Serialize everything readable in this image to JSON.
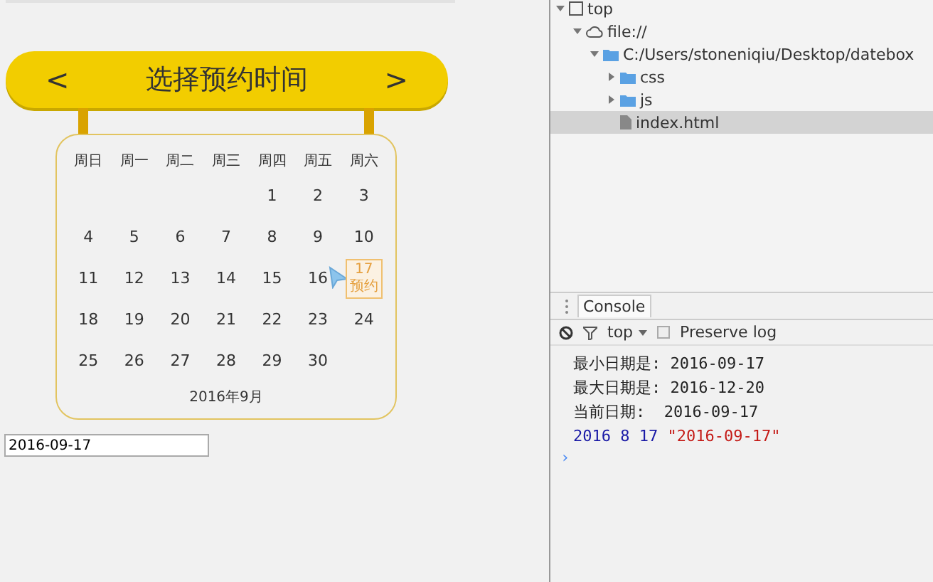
{
  "picker": {
    "prev": "<",
    "title": "选择预约时间",
    "next": ">",
    "weekdays": [
      "周日",
      "周一",
      "周二",
      "周三",
      "周四",
      "周五",
      "周六"
    ],
    "weeks": [
      {
        "right_aligned": true,
        "days": [
          {
            "day": "1",
            "selected": false
          },
          {
            "day": "2",
            "selected": false
          },
          {
            "day": "3",
            "selected": false
          }
        ]
      },
      {
        "days": [
          {
            "day": "4",
            "selected": false
          },
          {
            "day": "5",
            "selected": false
          },
          {
            "day": "6",
            "selected": false
          },
          {
            "day": "7",
            "selected": false
          },
          {
            "day": "8",
            "selected": false
          },
          {
            "day": "9",
            "selected": false
          },
          {
            "day": "10",
            "selected": false
          }
        ]
      },
      {
        "days": [
          {
            "day": "11",
            "selected": false
          },
          {
            "day": "12",
            "selected": false
          },
          {
            "day": "13",
            "selected": false
          },
          {
            "day": "14",
            "selected": false
          },
          {
            "day": "15",
            "selected": false
          },
          {
            "day": "16",
            "selected": false
          },
          {
            "day": "17",
            "selected": true,
            "tag": "预约"
          }
        ]
      },
      {
        "days": [
          {
            "day": "18",
            "selected": false
          },
          {
            "day": "19",
            "selected": false
          },
          {
            "day": "20",
            "selected": false
          },
          {
            "day": "21",
            "selected": false
          },
          {
            "day": "22",
            "selected": false
          },
          {
            "day": "23",
            "selected": false
          },
          {
            "day": "24",
            "selected": false
          }
        ]
      },
      {
        "right_aligned": false,
        "days": [
          {
            "day": "25",
            "selected": false
          },
          {
            "day": "26",
            "selected": false
          },
          {
            "day": "27",
            "selected": false
          },
          {
            "day": "28",
            "selected": false
          },
          {
            "day": "29",
            "selected": false
          },
          {
            "day": "30",
            "selected": false
          }
        ]
      }
    ],
    "month": "2016年9月"
  },
  "date_field": {
    "value": "2016-09-17"
  },
  "frames_tree": [
    {
      "label": "top",
      "kind": "frame",
      "expanded": true,
      "selected": false,
      "children": [
        {
          "label": "file://",
          "kind": "cloud",
          "expanded": true,
          "selected": false,
          "children": [
            {
              "label": "C:/Users/stoneniqiu/Desktop/datebox",
              "kind": "folder",
              "expanded": true,
              "selected": false,
              "children": [
                {
                  "label": "css",
                  "kind": "folder",
                  "expanded": false,
                  "selected": false
                },
                {
                  "label": "js",
                  "kind": "folder",
                  "expanded": false,
                  "selected": false
                },
                {
                  "label": "index.html",
                  "kind": "file",
                  "selected": true
                }
              ]
            }
          ]
        }
      ]
    }
  ],
  "console": {
    "tab": "Console",
    "context": "top",
    "preserve_log": {
      "label": "Preserve log",
      "checked": false
    },
    "lines": [
      {
        "segments": [
          {
            "text": "最小日期是: 2016-09-17",
            "color": "#222222"
          }
        ]
      },
      {
        "segments": [
          {
            "text": "最大日期是: 2016-12-20",
            "color": "#222222"
          }
        ]
      },
      {
        "segments": [
          {
            "text": "当前日期:  2016-09-17",
            "color": "#222222"
          }
        ]
      },
      {
        "segments": [
          {
            "text": "2016 8 17 ",
            "color": "#1a1aa6"
          },
          {
            "text": "\"2016-09-17\"",
            "color": "#c41a16"
          }
        ]
      }
    ],
    "prompt": "›"
  }
}
